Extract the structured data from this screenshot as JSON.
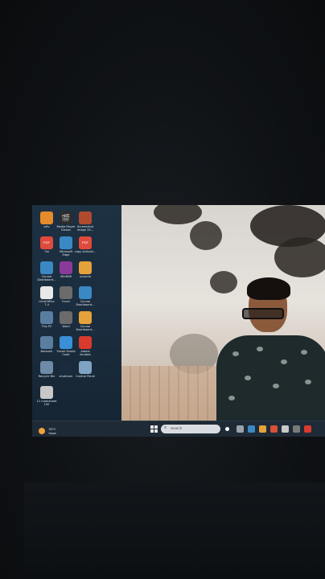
{
  "desktop": {
    "icons": [
      {
        "id": "ottv",
        "label": "ottv",
        "color": "#e58b2a",
        "glyph": ""
      },
      {
        "id": "media",
        "label": "Media Player\nClassic",
        "color": "#2b2b2b",
        "glyph": "🎬"
      },
      {
        "id": "screenshot",
        "label": "Screenshot\nImage 20...",
        "color": "#b24a2e",
        "glyph": ""
      },
      {
        "id": "txt",
        "label": "Txt",
        "color": "#e04a3c",
        "glyph": "PDF"
      },
      {
        "id": "edge1",
        "label": "Microsoft\nEdge",
        "color": "#3a89c4",
        "glyph": ""
      },
      {
        "id": "copy",
        "label": "copy Activati...",
        "color": "#e04a3c",
        "glyph": "PDF"
      },
      {
        "id": "course1",
        "label": "Course\nDashboard...",
        "color": "#3a89c4",
        "glyph": ""
      },
      {
        "id": "winrar",
        "label": "WinRAR",
        "color": "#8c3a9a",
        "glyph": ""
      },
      {
        "id": "unsecte",
        "label": "unsecte",
        "color": "#e5a23a",
        "glyph": ""
      },
      {
        "id": "libre",
        "label": "LibreOffice\n7.4",
        "color": "#e8e8e8",
        "glyph": ""
      },
      {
        "id": "excel",
        "label": "Excel",
        "color": "#6b6b6b",
        "glyph": ""
      },
      {
        "id": "course2",
        "label": "Course\nDashboard...",
        "color": "#3a89c4",
        "glyph": ""
      },
      {
        "id": "thispc",
        "label": "This PC",
        "color": "#5a7ea0",
        "glyph": ""
      },
      {
        "id": "word",
        "label": "Word",
        "color": "#6b6b6b",
        "glyph": ""
      },
      {
        "id": "course3",
        "label": "Course\nDashboard...",
        "color": "#e5a23a",
        "glyph": ""
      },
      {
        "id": "network",
        "label": "Network",
        "color": "#5a7ea0",
        "glyph": ""
      },
      {
        "id": "vscode",
        "label": "Visual Studio\nCode",
        "color": "#3a8fd6",
        "glyph": ""
      },
      {
        "id": "acrobat",
        "label": "Adobe\nAcrobat",
        "color": "#d83b2d",
        "glyph": ""
      },
      {
        "id": "recycle",
        "label": "Recycle Bin",
        "color": "#6d8aa6",
        "glyph": ""
      },
      {
        "id": "blank",
        "label": "shubham",
        "color": "#1a2c3d",
        "glyph": ""
      },
      {
        "id": "control",
        "label": "Control Panel",
        "color": "#7fa3c2",
        "glyph": ""
      },
      {
        "id": "marksheet",
        "label": "12 marksheet\n150",
        "color": "#c8c8c8",
        "glyph": ""
      }
    ]
  },
  "taskbar": {
    "weather_temp": "33°C",
    "weather_desc": "Haze",
    "search_placeholder": "Search",
    "search_glyph": "⌕",
    "pinned_colors": [
      "#ffffff",
      "#9aa3ab",
      "#3a89c4",
      "#e5a23a",
      "#d94f3a",
      "#c8c8c8",
      "#7a7a7a",
      "#d83b2d"
    ]
  }
}
